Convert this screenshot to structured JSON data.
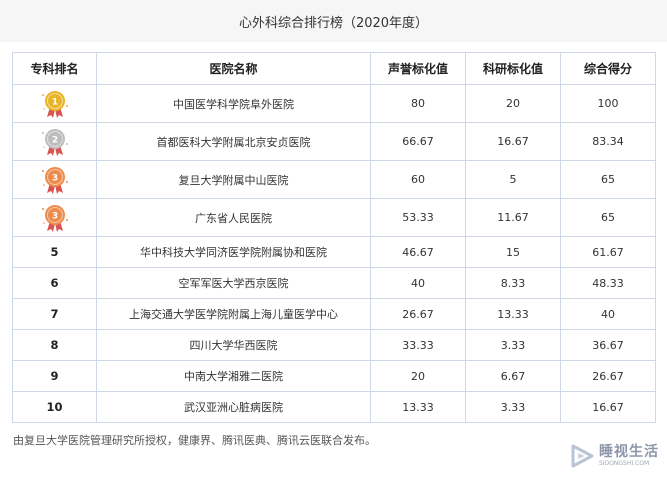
{
  "page_title": "心外科综合排行榜（2020年度）",
  "table": {
    "headers": [
      "专科排名",
      "医院名称",
      "声誉标化值",
      "科研标化值",
      "综合得分"
    ],
    "rows": [
      {
        "rank": "1",
        "medal": "gold",
        "hospital": "中国医学科学院阜外医院",
        "reputation": "80",
        "research": "20",
        "total": "100"
      },
      {
        "rank": "2",
        "medal": "silver",
        "hospital": "首都医科大学附属北京安贞医院",
        "reputation": "66.67",
        "research": "16.67",
        "total": "83.34"
      },
      {
        "rank": "3",
        "medal": "bronze",
        "hospital": "复旦大学附属中山医院",
        "reputation": "60",
        "research": "5",
        "total": "65"
      },
      {
        "rank": "3",
        "medal": "bronze",
        "hospital": "广东省人民医院",
        "reputation": "53.33",
        "research": "11.67",
        "total": "65"
      },
      {
        "rank": "5",
        "medal": "",
        "hospital": "华中科技大学同济医学院附属协和医院",
        "reputation": "46.67",
        "research": "15",
        "total": "61.67"
      },
      {
        "rank": "6",
        "medal": "",
        "hospital": "空军军医大学西京医院",
        "reputation": "40",
        "research": "8.33",
        "total": "48.33"
      },
      {
        "rank": "7",
        "medal": "",
        "hospital": "上海交通大学医学院附属上海儿童医学中心",
        "reputation": "26.67",
        "research": "13.33",
        "total": "40"
      },
      {
        "rank": "8",
        "medal": "",
        "hospital": "四川大学华西医院",
        "reputation": "33.33",
        "research": "3.33",
        "total": "36.67"
      },
      {
        "rank": "9",
        "medal": "",
        "hospital": "中南大学湘雅二医院",
        "reputation": "20",
        "research": "6.67",
        "total": "26.67"
      },
      {
        "rank": "10",
        "medal": "",
        "hospital": "武汉亚洲心脏病医院",
        "reputation": "13.33",
        "research": "3.33",
        "total": "16.67"
      }
    ]
  },
  "footer_note": "由复旦大学医院管理研究所授权，健康界、腾讯医典、腾讯云医联合发布。",
  "logo": {
    "name": "睡视生活",
    "url": "SIDONGSHI.COM"
  },
  "colors": {
    "gold": "#e8b52a",
    "silver": "#bdbdbd",
    "bronze": "#ec8b4c",
    "ribbon": "#d9534f",
    "border": "#cfd8e6",
    "title_bg": "#f6f6f6"
  }
}
